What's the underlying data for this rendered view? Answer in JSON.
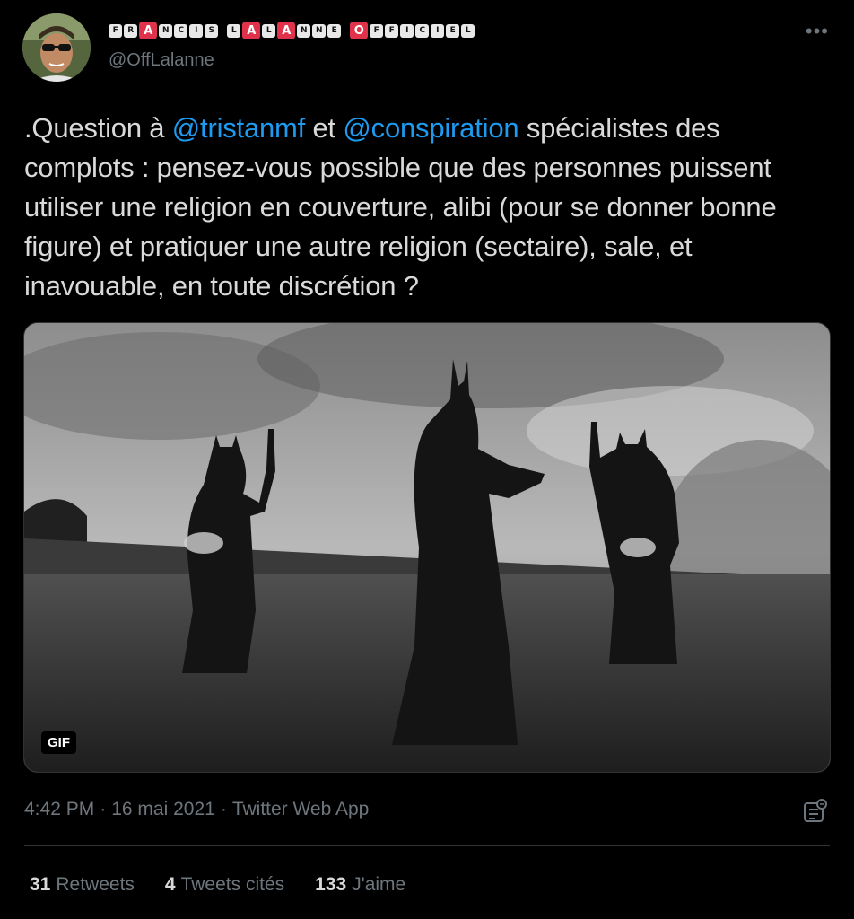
{
  "author": {
    "display_name_tiles": [
      "F",
      "R",
      "A",
      "N",
      "C",
      "I",
      "S",
      " ",
      "L",
      "A",
      "L",
      "A",
      "N",
      "N",
      "E",
      " ",
      "O",
      "F",
      "F",
      "I",
      "C",
      "I",
      "E",
      "L"
    ],
    "red_tiles": [
      2,
      9,
      11,
      16
    ],
    "handle": "@OffLalanne"
  },
  "more_label": "•••",
  "tweet": {
    "prefix": ".Question à ",
    "mention1": "@tristanmf",
    "middle": " et ",
    "mention2": "@conspiration",
    "rest": " spécialistes des complots : pensez-vous possible que des personnes puissent utiliser une religion en couverture, alibi (pour se donner bonne figure) et pratiquer une autre religion (sectaire), sale, et inavouable, en toute discrétion ?"
  },
  "media": {
    "badge": "GIF"
  },
  "meta": {
    "time": "4:42 PM",
    "separator": "·",
    "date": "16 mai 2021",
    "source": "Twitter Web App"
  },
  "stats": {
    "retweets_count": "31",
    "retweets_label": "Retweets",
    "quotes_count": "4",
    "quotes_label": "Tweets cités",
    "likes_count": "133",
    "likes_label": "J'aime"
  },
  "colors": {
    "background": "#000000",
    "accent": "#1d9bf0",
    "muted": "#6e767d",
    "tile_red": "#e0324a"
  },
  "icons": [
    "avatar-photo",
    "more-icon",
    "analytics-icon"
  ]
}
